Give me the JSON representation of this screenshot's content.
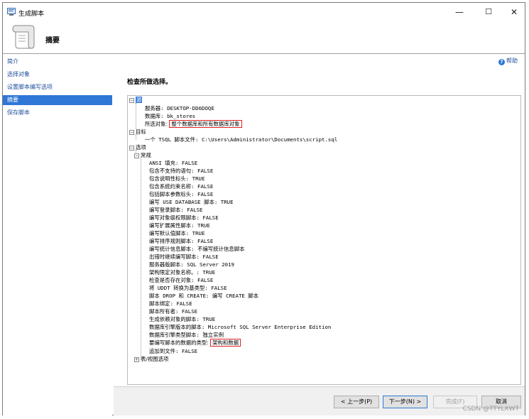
{
  "window": {
    "title": "生成脚本",
    "controls": {
      "minimize": "—",
      "maximize": "☐",
      "close": "✕"
    }
  },
  "header": {
    "title": "摘要"
  },
  "sidebar": {
    "items": [
      {
        "label": "简介",
        "active": false
      },
      {
        "label": "选择对象",
        "active": false
      },
      {
        "label": "设置脚本编写选项",
        "active": false
      },
      {
        "label": "摘要",
        "active": true
      },
      {
        "label": "保存脚本",
        "active": false
      }
    ]
  },
  "content": {
    "help_label": "帮助",
    "section_title": "检查所做选择。",
    "tree": {
      "source": {
        "label": "源",
        "server": "服务器: DESKTOP-DD6DOQE",
        "database": "数据库: bk_stores",
        "selected_prefix": "所选对象: ",
        "selected_value": "整个数据库和所有数据库对象"
      },
      "target": {
        "label": "目标",
        "file": "一个 TSQL 脚本文件: C:\\Users\\Administrator\\Documents\\script.sql"
      },
      "options": {
        "label": "选项",
        "general": {
          "label": "常规",
          "items": [
            "ANSI 填充: FALSE",
            "包含不支持的语句: FALSE",
            "包含说明性标头: TRUE",
            "包含系统约束名称: FALSE",
            "包括脚本参数标头: FALSE",
            "编写 USE DATABASE 脚本: TRUE",
            "编写登录脚本: FALSE",
            "编写对象级权限脚本: FALSE",
            "编写扩展属性脚本: TRUE",
            "编写默认值脚本: TRUE",
            "编写排序规则脚本: FALSE",
            "编写统计信息脚本: 不编写统计信息脚本",
            "出错时继续编写脚本: FALSE",
            "服务器版脚本: SQL Server 2019",
            "架构限定对象名称。: TRUE",
            "检查是否存在对象: FALSE",
            "将 UDDT 转换为基类型: FALSE",
            "脚本 DROP 和 CREATE: 编写 CREATE 脚本",
            "脚本绑定: FALSE",
            "脚本所有者: FALSE",
            "生成依赖对象的脚本: TRUE",
            "数据库引擎版本的脚本: Microsoft SQL Server Enterprise Edition",
            "数据库引擎类型脚本: 独立实例"
          ],
          "data_types_prefix": "要编写脚本的数据的类型: ",
          "data_types_value": "架构和数据",
          "append_to_file": "追加到文件: FALSE"
        },
        "table_view": {
          "label": "表/视图选项"
        }
      }
    }
  },
  "footer": {
    "prev_button": "< 上一步(P)",
    "next_button": "下一步(N) >",
    "finish_button": "完成(F)",
    "cancel_button": "取消",
    "watermark": "CSDN @TTYLXWT"
  }
}
